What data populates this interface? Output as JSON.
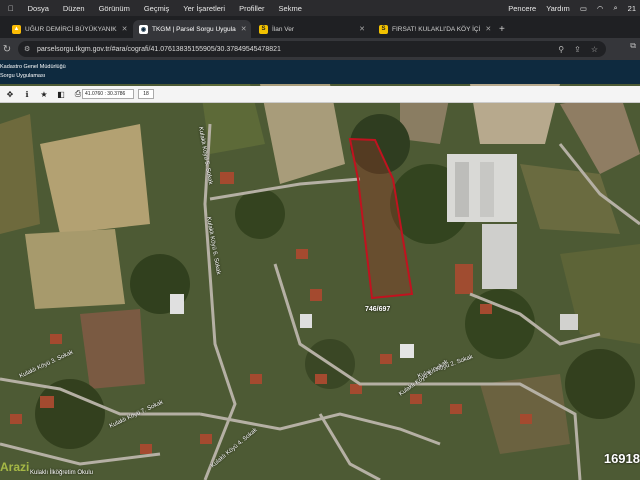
{
  "menubar": {
    "items": [
      "Dosya",
      "Düzen",
      "Görünüm",
      "Geçmiş",
      "Yer İşaretleri",
      "Profiller",
      "Sekme"
    ],
    "right_items": [
      "Pencere",
      "Yardım"
    ],
    "time": "21"
  },
  "tabs": [
    {
      "label": "UĞUR DEMİRCİ BÜYÜKYANIK",
      "active": false,
      "favicon": "drive-icon"
    },
    {
      "label": "TKGM | Parsel Sorgu Uygula",
      "active": true,
      "favicon": "tkgm-icon"
    },
    {
      "label": "İlan Ver",
      "active": false,
      "favicon": "s-icon"
    },
    {
      "label": "FIRSAT! KULAKLI'DA KÖY İÇİ",
      "active": false,
      "favicon": "s-icon"
    }
  ],
  "address": {
    "url": "parselsorgu.tkgm.gov.tr/#ara/cografi/41.07613835155905/30.37849545478821"
  },
  "site": {
    "org": "Kadastro Genel Müdürlüğü",
    "app": "Sorgu Uygulaması"
  },
  "toolbar": {
    "coords": "41.0760 : 30.3786",
    "zoom": "18"
  },
  "map": {
    "parcel": "746/697",
    "roads": [
      "Kulaklı Köyü 5. Sokak",
      "Kulaklı Köyü 6. Sokak",
      "Kulaklı Köyü 2. Sokak",
      "Kulaklı Köyü 1. Sokak",
      "Kulaklı Köyü 3. Sokak",
      "Kulaklı Köyü 7. Sokak",
      "Kulaklı Köyü 4. Sokak",
      "Kulaklı İlköğretim Okulu"
    ],
    "scale_text": "16918",
    "watermark": "Arazi"
  },
  "colors": {
    "parcel_outline": "#c1121f",
    "header_bg": "#0e2a3f"
  }
}
